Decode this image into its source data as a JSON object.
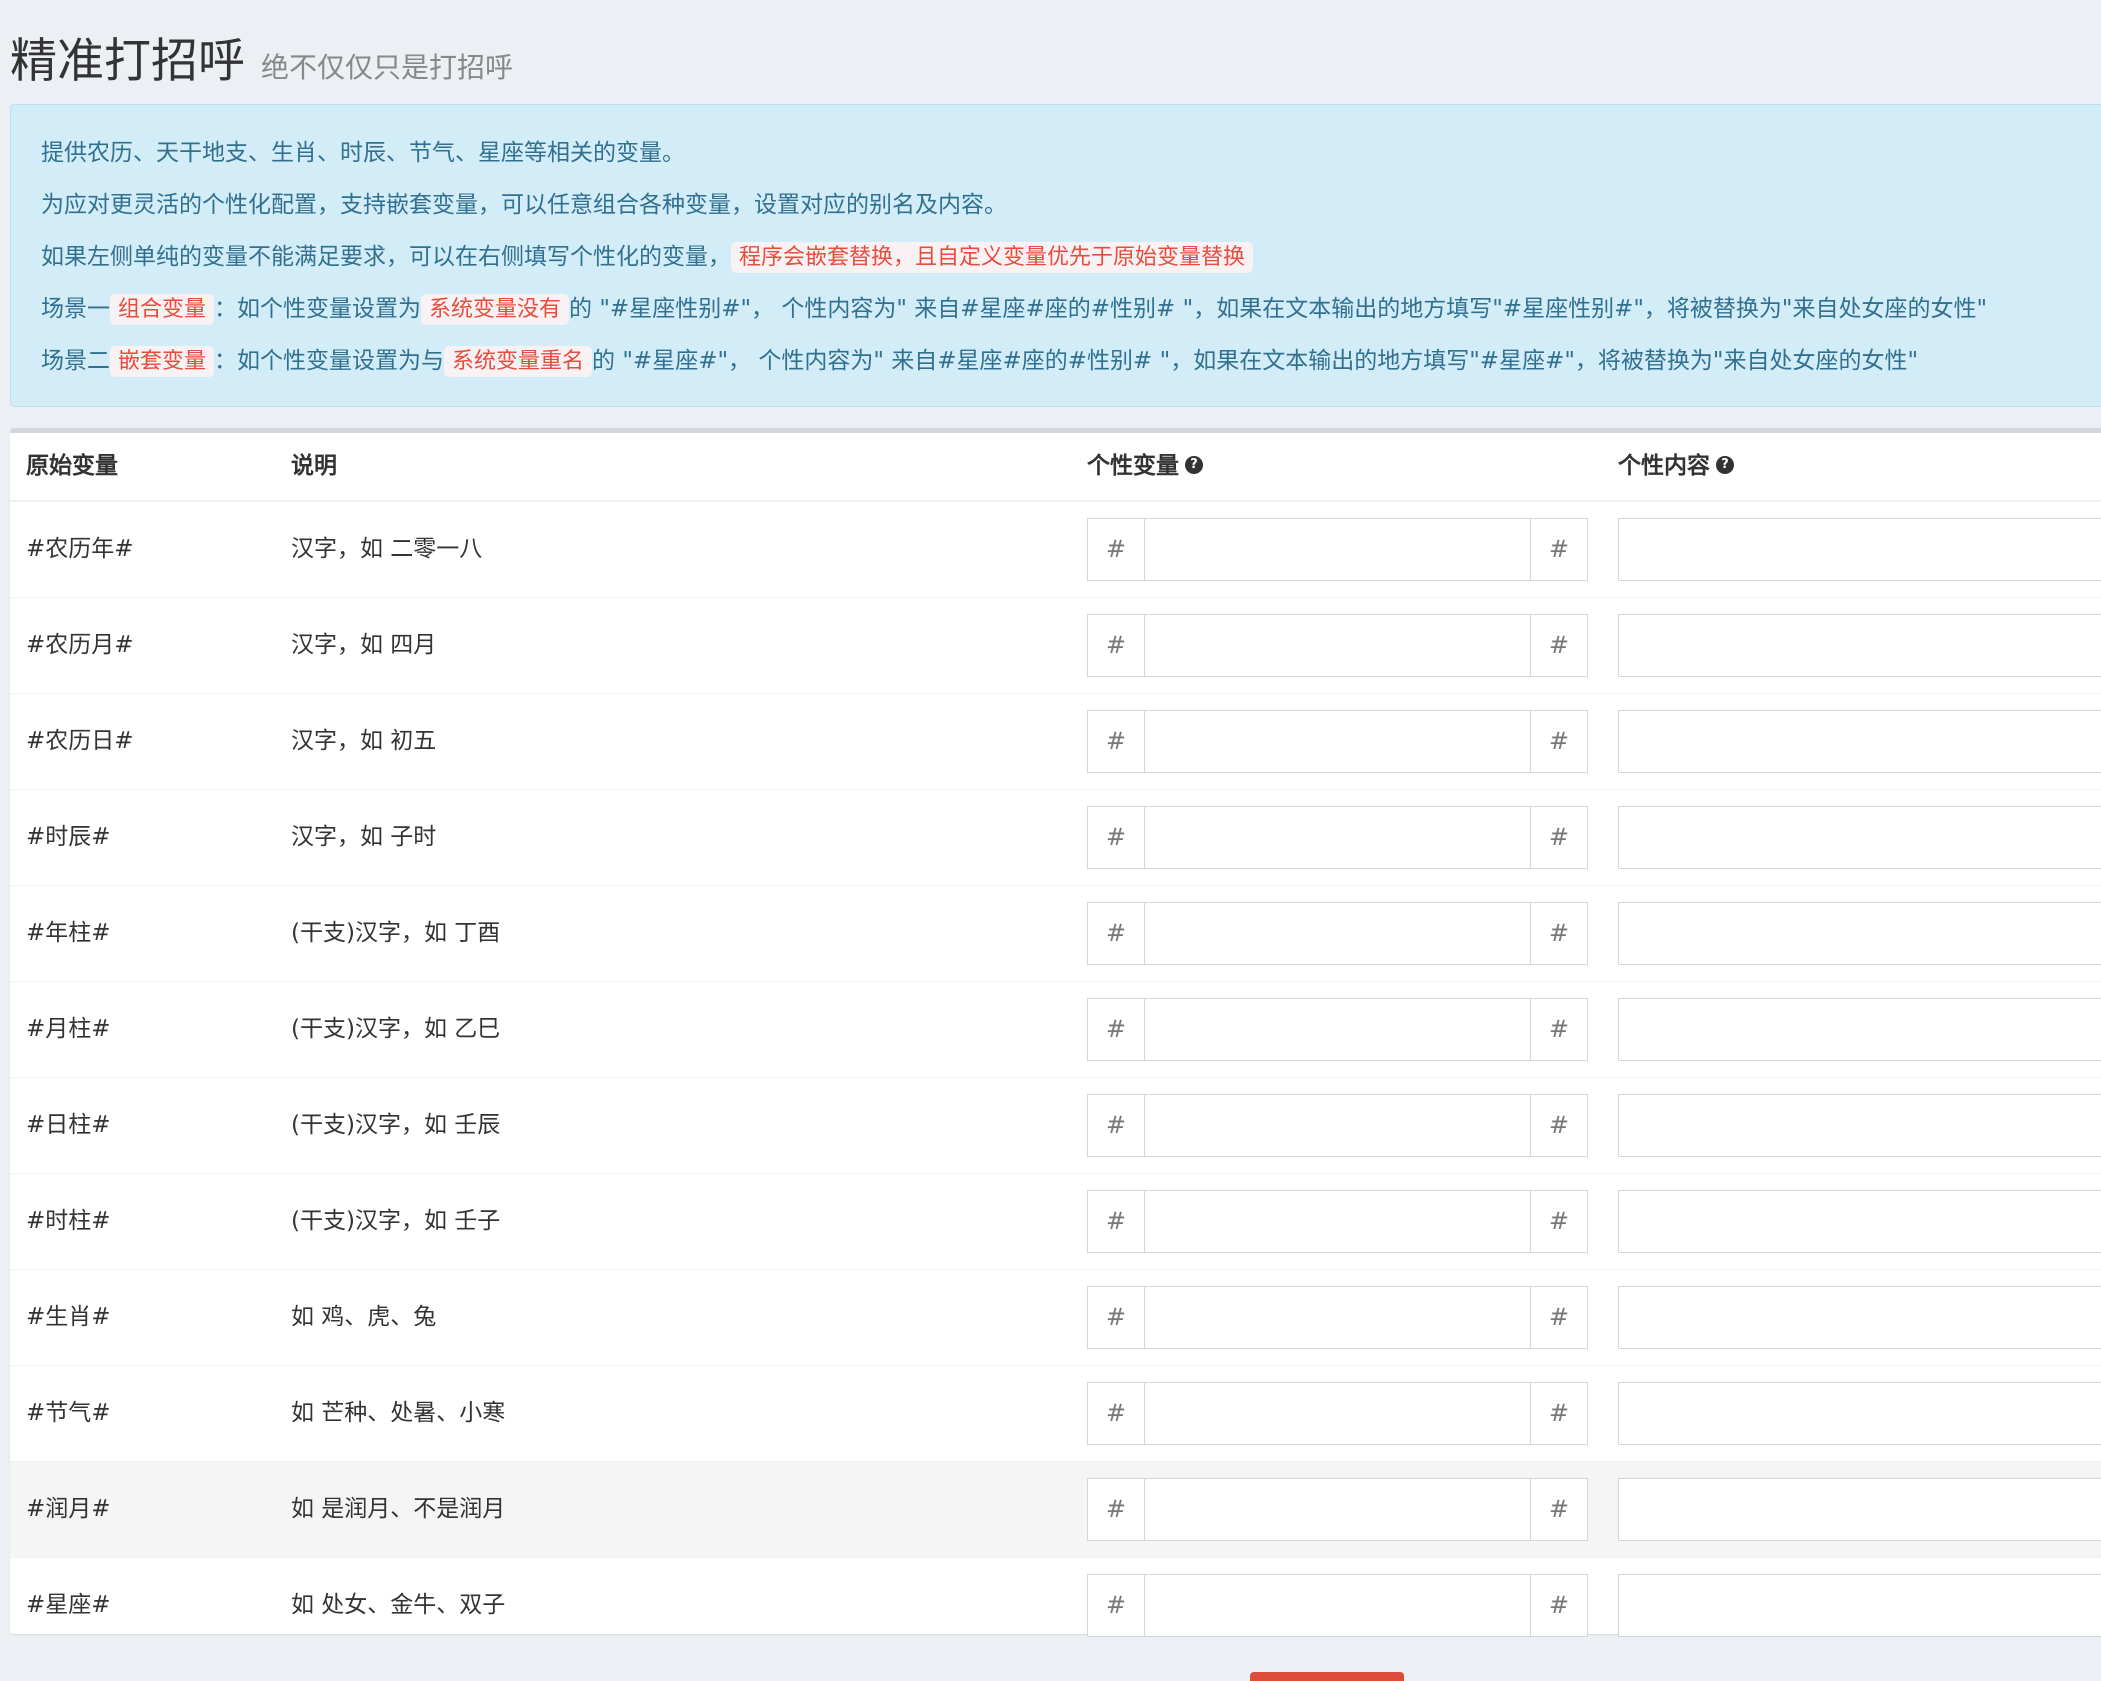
{
  "header": {
    "title": "精准打招呼",
    "subtitle": "绝不仅仅只是打招呼"
  },
  "callout": {
    "line1": "提供农历、天干地支、生肖、时辰、节气、星座等相关的变量。",
    "line2": "为应对更灵活的个性化配置，支持嵌套变量，可以任意组合各种变量，设置对应的别名及内容。",
    "line3_prefix": "如果左侧单纯的变量不能满足要求，可以在右侧填写个性化的变量，",
    "line3_highlight": "程序会嵌套替换，且自定义变量优先于原始变量替换",
    "scene1": {
      "label": "场景一",
      "tag": "组合变量",
      "text_a": "：如个性变量设置为",
      "tag2": "系统变量没有",
      "text_b": "的 \"#星座性别#\"， 个性内容为\" 来自#星座#座的#性别# \"，如果在文本输出的地方填写\"#星座性别#\"，将被替换为\"来自处女座的女性\""
    },
    "scene2": {
      "label": "场景二",
      "tag": "嵌套变量",
      "text_a": "：如个性变量设置为与",
      "tag2": "系统变量重名",
      "text_b": "的 \"#星座#\"， 个性内容为\" 来自#星座#座的#性别# \"，如果在文本输出的地方填写\"#星座#\"，将被替换为\"来自处女座的女性\""
    }
  },
  "table": {
    "headers": {
      "variable": "原始变量",
      "description": "说明",
      "alias": "个性变量",
      "content": "个性内容"
    },
    "hash": "#",
    "help_glyph": "?",
    "rows": [
      {
        "variable": "#农历年#",
        "description": "汉字，如 二零一八"
      },
      {
        "variable": "#农历月#",
        "description": "汉字，如 四月"
      },
      {
        "variable": "#农历日#",
        "description": "汉字，如 初五"
      },
      {
        "variable": "#时辰#",
        "description": "汉字，如 子时"
      },
      {
        "variable": "#年柱#",
        "description": "(干支)汉字，如 丁酉"
      },
      {
        "variable": "#月柱#",
        "description": "(干支)汉字，如 乙巳"
      },
      {
        "variable": "#日柱#",
        "description": "(干支)汉字，如 壬辰"
      },
      {
        "variable": "#时柱#",
        "description": "(干支)汉字，如 壬子"
      },
      {
        "variable": "#生肖#",
        "description": "如 鸡、虎、兔"
      },
      {
        "variable": "#节气#",
        "description": "如 芒种、处暑、小寒"
      },
      {
        "variable": "#润月#",
        "description": "如 是润月、不是润月"
      },
      {
        "variable": "#星座#",
        "description": "如 处女、金牛、双子"
      }
    ]
  },
  "colors": {
    "page_bg": "#ecf0f5",
    "callout_bg": "#d2ecf8",
    "callout_text": "#31708f",
    "highlight_text": "#e74c3c",
    "highlight_bg": "#f9f2f4",
    "primary_button": "#dd4b39"
  }
}
